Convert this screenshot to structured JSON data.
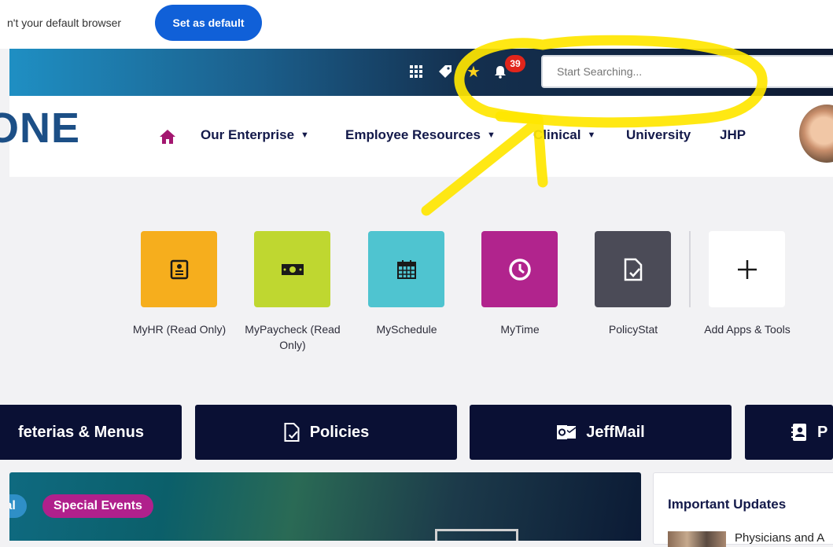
{
  "notice": {
    "text": "n't your default browser",
    "button": "Set as default"
  },
  "topbar": {
    "icons": [
      "grid-icon",
      "tag-icon",
      "star-icon",
      "bell-icon"
    ],
    "notification_count": "39",
    "search_placeholder": "Start Searching..."
  },
  "nav": {
    "logo": "ONE",
    "items": [
      {
        "label": "Our Enterprise",
        "dropdown": true
      },
      {
        "label": "Employee Resources",
        "dropdown": true
      },
      {
        "label": "Clinical",
        "dropdown": true
      },
      {
        "label": "University",
        "dropdown": false
      },
      {
        "label": "JHP",
        "dropdown": false
      }
    ]
  },
  "apps": [
    {
      "label": "MyHR (Read Only)",
      "color": "#f6ae1d",
      "icon": "id-card-icon"
    },
    {
      "label": "MyPaycheck (Read Only)",
      "color": "#bfd730",
      "icon": "money-icon"
    },
    {
      "label": "MySchedule",
      "color": "#4fc4d0",
      "icon": "calendar-icon"
    },
    {
      "label": "MyTime",
      "color": "#b1248d",
      "icon": "clock-icon"
    },
    {
      "label": "PolicyStat",
      "color": "#4b4b57",
      "icon": "document-check-icon"
    },
    {
      "label": "Add Apps & Tools",
      "color": "#ffffff",
      "icon": "plus-icon"
    }
  ],
  "quick_links": [
    {
      "label": "feterias & Menus",
      "icon": "none"
    },
    {
      "label": "Policies",
      "icon": "document-check-icon"
    },
    {
      "label": "JeffMail",
      "icon": "outlook-icon"
    },
    {
      "label": "P",
      "icon": "contact-book-icon"
    }
  ],
  "banner": {
    "tags": [
      "ial",
      "Special Events"
    ]
  },
  "updates": {
    "title": "Important Updates",
    "first_item": "Physicians and A"
  },
  "colors": {
    "annotation": "#ffe600",
    "nav_text": "#13194a",
    "quick_link_bg": "#0a1034",
    "primary_blue": "#1060d8"
  }
}
